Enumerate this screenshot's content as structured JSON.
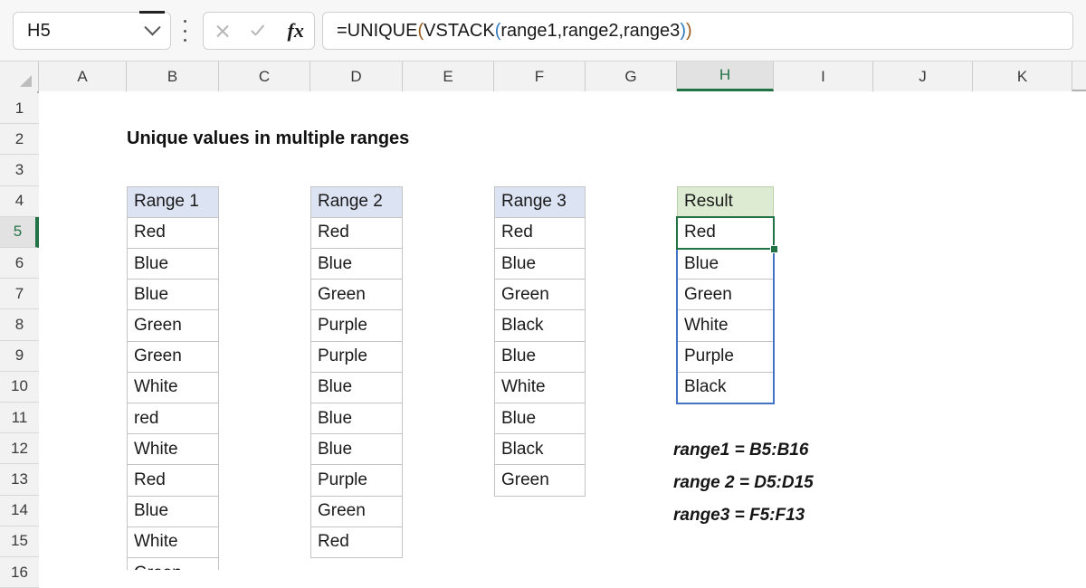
{
  "app": {
    "name_box": {
      "value": "H5",
      "icon": "chevron-down-icon"
    },
    "toolbar": {
      "kebab": "more-options-icon",
      "cancel": "cancel-icon",
      "enter": "enter-icon",
      "insert_function": "fx"
    },
    "formula_bar": {
      "full_text": "=UNIQUE(VSTACK(range1,range2,range3))",
      "segment_1": "=UNIQUE",
      "paren_open_1": "(",
      "segment_2": "VSTACK",
      "paren_open_2": "(",
      "segment_3": "range1,range2,range3",
      "paren_close_2": ")",
      "paren_close_1": ")"
    }
  },
  "grid": {
    "columns": [
      "A",
      "B",
      "C",
      "D",
      "E",
      "F",
      "G",
      "H",
      "I",
      "J",
      "K"
    ],
    "active_column": "H",
    "rows": [
      "1",
      "2",
      "3",
      "4",
      "5",
      "6",
      "7",
      "8",
      "9",
      "10",
      "11",
      "12",
      "13",
      "14",
      "15",
      "16"
    ],
    "active_row": "5",
    "title": "Unique values in multiple ranges"
  },
  "ranges": {
    "range1": {
      "header": "Range 1",
      "values": [
        "Red",
        "Blue",
        "Blue",
        "Green",
        "Green",
        "White",
        "red",
        "White",
        "Red",
        "Blue",
        "White",
        "Green"
      ]
    },
    "range2": {
      "header": "Range 2",
      "values": [
        "Red",
        "Blue",
        "Green",
        "Purple",
        "Purple",
        "Blue",
        "Blue",
        "Blue",
        "Purple",
        "Green",
        "Red"
      ]
    },
    "range3": {
      "header": "Range 3",
      "values": [
        "Red",
        "Blue",
        "Green",
        "Black",
        "Blue",
        "White",
        "Blue",
        "Black",
        "Green"
      ]
    },
    "result": {
      "header": "Result",
      "values": [
        "Red",
        "Blue",
        "Green",
        "White",
        "Purple",
        "Black"
      ]
    }
  },
  "notes": [
    "range1 = B5:B16",
    "range 2 = D5:D15",
    "range3 = F5:F13"
  ],
  "colors": {
    "excel_green": "#217346",
    "spill_blue": "#4472C4",
    "header_blue_fill": "#DCE3F2",
    "result_green_fill": "#DDEBD3"
  }
}
